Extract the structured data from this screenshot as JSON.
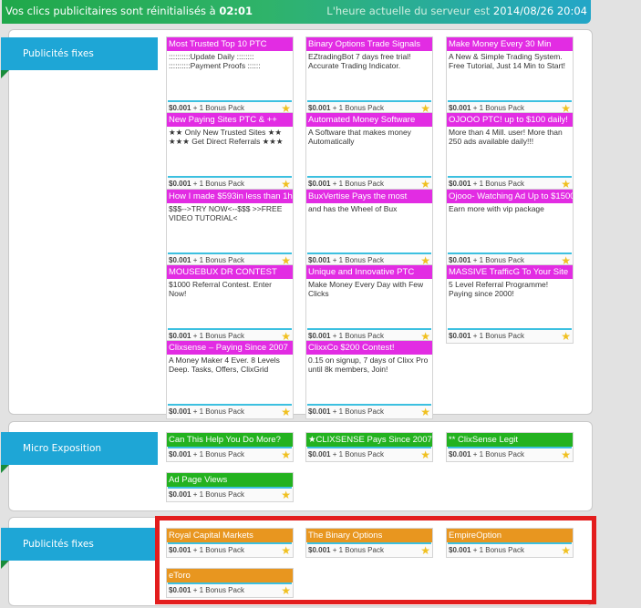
{
  "header": {
    "reset_label": "Vos clics publicitaires sont réinitialisés à",
    "reset_time": "02:01",
    "server_label": "L'heure actuelle du serveur est",
    "server_time": "2014/08/26 20:04"
  },
  "sections": [
    {
      "title": "Publicités fixes",
      "ads": [
        {
          "title": "Most Trusted Top 10 PTC",
          "desc": "::::::::::Update Daily ::::::::\n::::::::::Payment Proofs ::::::"
        },
        {
          "title": "Binary Options Trade Signals",
          "desc": "EZtradingBot 7 days free trial! Accurate Trading Indicator."
        },
        {
          "title": "Make Money Every 30 Min",
          "desc": "A New & Simple Trading System. Free Tutorial, Just 14 Min to Start!"
        },
        {
          "title": "New Paying Sites PTC & ++",
          "desc": "★★ Only New Trusted Sites ★★\n★★★ Get Direct Referrals ★★★"
        },
        {
          "title": "Automated Money Software",
          "desc": "A Software that makes money Automatically"
        },
        {
          "title": "OJOOO PTC! up to $100 daily!",
          "desc": "More than 4 Mill. user! More than 250 ads available daily!!!"
        },
        {
          "title": "How I made $593in less than 1h",
          "desc": "$$$-->TRY NOW<--$$$ >>FREE VIDEO TUTORIAL<"
        },
        {
          "title": "BuxVertise Pays the most",
          "desc": "and has the Wheel of Bux"
        },
        {
          "title": "Ojooo- Watching Ad Up to $1500",
          "desc": "Earn more with vip package"
        },
        {
          "title": "MOUSEBUX DR CONTEST",
          "desc": "$1000 Referral Contest. Enter Now!"
        },
        {
          "title": "Unique and Innovative PTC",
          "desc": "Make Money Every Day with Few Clicks"
        },
        {
          "title": "MASSIVE TrafficG To Your Site",
          "desc": "5 Level Referral Programme! Paying since 2000!"
        },
        {
          "title": "Clixsense – Paying Since 2007",
          "desc": "A Money Maker 4 Ever. 8 Levels Deep. Tasks, Offers, ClixGrid"
        },
        {
          "title": "ClixxCo $200 Contest!",
          "desc": "0.15 on signup, 7 days of Clixx Pro until 8k members, Join!"
        }
      ]
    },
    {
      "title": "Micro Exposition",
      "ads": [
        {
          "title": "Can This Help You Do More?"
        },
        {
          "title": "★CLIXSENSE Pays Since 2007★"
        },
        {
          "title": "** ClixSense Legit"
        },
        {
          "title": "Ad Page Views"
        }
      ]
    },
    {
      "title": "Publicités fixes",
      "ads": [
        {
          "title": "Royal Capital Markets"
        },
        {
          "title": "The Binary Options"
        },
        {
          "title": "EmpireOption"
        },
        {
          "title": "eToro"
        }
      ]
    }
  ],
  "price": "$0.001",
  "bonus": "+ 1 Bonus Pack",
  "colors": {
    "pink": "#e22ce3",
    "green": "#23b21f",
    "orange": "#e8961f",
    "ribbon": "#1ea6d6",
    "highlight": "#e31d1d"
  },
  "icons": {
    "bonus": "star-icon"
  }
}
